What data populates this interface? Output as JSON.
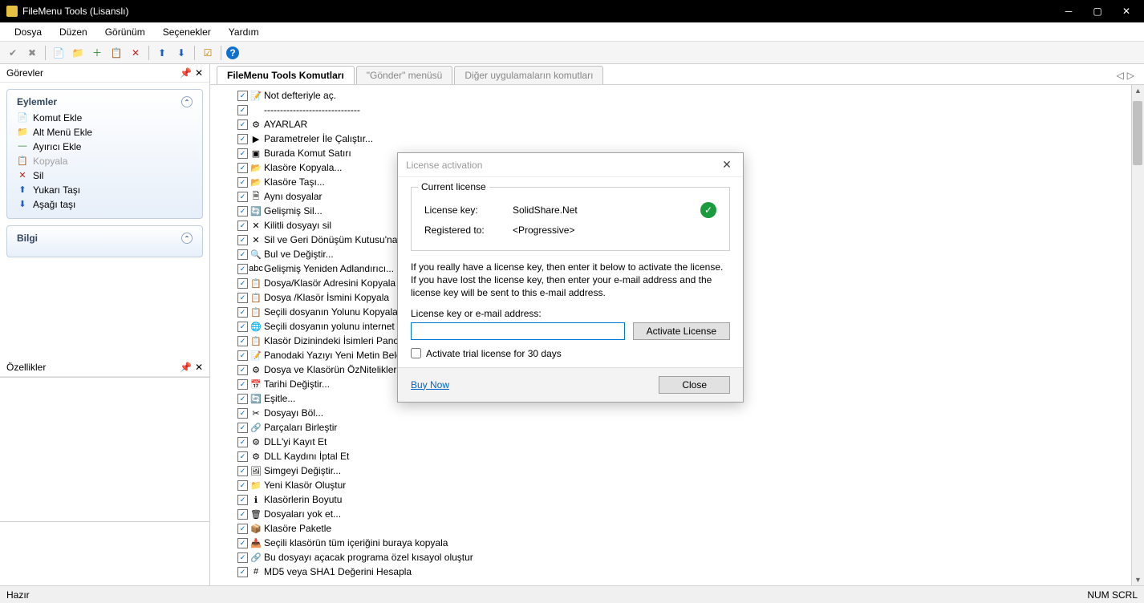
{
  "window": {
    "title": "FileMenu Tools (Lisanslı)"
  },
  "menubar": [
    "Dosya",
    "Düzen",
    "Görünüm",
    "Seçenekler",
    "Yardım"
  ],
  "panels": {
    "tasks": "Görevler",
    "props": "Özellikler"
  },
  "sections": {
    "actions": "Eylemler",
    "info": "Bilgi"
  },
  "actions": [
    {
      "label": "Komut Ekle",
      "icon": "📄",
      "cls": "ic-green"
    },
    {
      "label": "Alt Menü Ekle",
      "icon": "📁",
      "cls": "ic-green"
    },
    {
      "label": "Ayırıcı Ekle",
      "icon": "—",
      "cls": "ic-green"
    },
    {
      "label": "Kopyala",
      "icon": "📋",
      "cls": "",
      "disabled": true
    },
    {
      "label": "Sil",
      "icon": "✕",
      "cls": "ic-red"
    },
    {
      "label": "Yukarı Taşı",
      "icon": "⬆",
      "cls": "ic-blue"
    },
    {
      "label": "Aşağı taşı",
      "icon": "⬇",
      "cls": "ic-blue"
    }
  ],
  "tabs": [
    {
      "label": "FileMenu Tools Komutları",
      "active": true
    },
    {
      "label": "\"Gönder\" menüsü",
      "active": false
    },
    {
      "label": "Diğer uygulamaların komutları",
      "active": false
    }
  ],
  "tree": [
    {
      "label": "Not defteriyle aç.",
      "icon": "📝"
    },
    {
      "label": "------------------------------",
      "icon": ""
    },
    {
      "label": "AYARLAR",
      "icon": "⚙"
    },
    {
      "label": "Parametreler İle Çalıştır...",
      "icon": "▶"
    },
    {
      "label": "Burada Komut Satırı",
      "icon": "▣"
    },
    {
      "label": "Klasöre Kopyala...",
      "icon": "📂"
    },
    {
      "label": "Klasöre Taşı...",
      "icon": "📂"
    },
    {
      "label": "Aynı dosyalar",
      "icon": "🗎"
    },
    {
      "label": "Gelişmiş Sil...",
      "icon": "🔄"
    },
    {
      "label": "Kilitli dosyayı sil",
      "icon": "✕"
    },
    {
      "label": "Sil ve Geri Dönüşüm Kutusu'na t",
      "icon": "✕"
    },
    {
      "label": "Bul ve Değiştir...",
      "icon": "🔍"
    },
    {
      "label": "Gelişmiş Yeniden Adlandırıcı...",
      "icon": "abc"
    },
    {
      "label": "Dosya/Klasör Adresini Kopyala",
      "icon": "📋"
    },
    {
      "label": "Dosya /Klasör İsmini Kopyala",
      "icon": "📋"
    },
    {
      "label": "Seçili dosyanın  Yolunu Kopyala",
      "icon": "📋"
    },
    {
      "label": "Seçili dosyanın  yolunu internet",
      "icon": "🌐"
    },
    {
      "label": "Klasör Dizinindeki İsimleri Panoy",
      "icon": "📋"
    },
    {
      "label": " Panodaki Yazıyı Yeni Metin Belge",
      "icon": "📝"
    },
    {
      "label": "Dosya ve Klasörün ÖzNitelikleri",
      "icon": "⚙"
    },
    {
      "label": "Tarihi Değiştir...",
      "icon": "📅"
    },
    {
      "label": "Eşitle...",
      "icon": "🔄"
    },
    {
      "label": "Dosyayı Böl...",
      "icon": "✂"
    },
    {
      "label": "Parçaları Birleştir",
      "icon": "🔗"
    },
    {
      "label": "DLL'yi Kayıt Et",
      "icon": "⚙"
    },
    {
      "label": "DLL Kaydını İptal Et",
      "icon": "⚙"
    },
    {
      "label": "Simgeyi Değiştir...",
      "icon": "🖼"
    },
    {
      "label": "Yeni Klasör Oluştur",
      "icon": "📁"
    },
    {
      "label": "Klasörlerin Boyutu",
      "icon": "ℹ"
    },
    {
      "label": "Dosyaları yok et...",
      "icon": "🗑"
    },
    {
      "label": "Klasöre Paketle",
      "icon": "📦"
    },
    {
      "label": "Seçili klasörün tüm içeriğini buraya kopyala",
      "icon": "📥"
    },
    {
      "label": "Bu dosyayı açacak programa özel kısayol oluştur",
      "icon": "🔗"
    },
    {
      "label": "MD5 veya SHA1 Değerini Hesapla",
      "icon": "#"
    }
  ],
  "dialog": {
    "title": "License activation",
    "group": "Current license",
    "keyLabel": "License key:",
    "keyValue": "SolidShare.Net",
    "regLabel": "Registered to:",
    "regValue": "<Progressive>",
    "message": "If you really have a license key, then enter it below to activate the license. If you have lost the license key, then enter your e-mail address and the license key will be sent to this e-mail address.",
    "fieldLabel": "License key or e-mail address:",
    "activateBtn": "Activate License",
    "trialChk": "Activate trial license for 30 days",
    "buyNow": "Buy Now",
    "close": "Close"
  },
  "status": {
    "ready": "Hazır",
    "indicators": "NUM  SCRL"
  }
}
